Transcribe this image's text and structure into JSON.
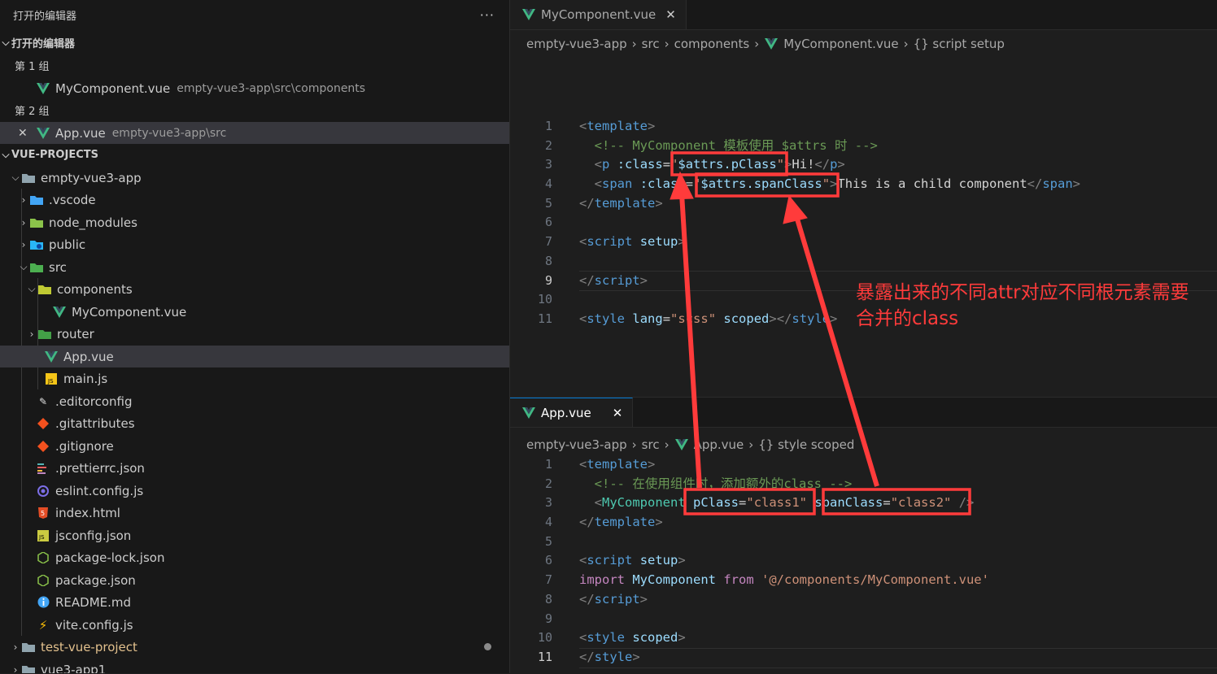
{
  "explorer": {
    "title": "打开的编辑器",
    "more": "···",
    "open_editors_section": "打开的编辑器",
    "group1": "第 1 组",
    "group1_file": "MyComponent.vue",
    "group1_path": "empty-vue3-app\\src\\components",
    "group2": "第 2 组",
    "group2_close": "✕",
    "group2_file": "App.vue",
    "group2_path": "empty-vue3-app\\src",
    "projects_section": "VUE-PROJECTS",
    "tree": [
      {
        "label": "empty-vue3-app",
        "icon": "folder-open-icon"
      },
      {
        "label": ".vscode",
        "icon": "vscode-folder-icon"
      },
      {
        "label": "node_modules",
        "icon": "node-folder-icon"
      },
      {
        "label": "public",
        "icon": "public-folder-icon"
      },
      {
        "label": "src",
        "icon": "src-folder-icon"
      },
      {
        "label": "components",
        "icon": "components-folder-icon"
      },
      {
        "label": "MyComponent.vue",
        "icon": "vue-icon"
      },
      {
        "label": "router",
        "icon": "router-folder-icon"
      },
      {
        "label": "App.vue",
        "icon": "vue-icon"
      },
      {
        "label": "main.js",
        "icon": "js-icon"
      },
      {
        "label": ".editorconfig",
        "icon": "editorconfig-icon"
      },
      {
        "label": ".gitattributes",
        "icon": "git-icon"
      },
      {
        "label": ".gitignore",
        "icon": "git-icon"
      },
      {
        "label": ".prettierrc.json",
        "icon": "prettier-icon"
      },
      {
        "label": "eslint.config.js",
        "icon": "eslint-icon"
      },
      {
        "label": "index.html",
        "icon": "html-icon"
      },
      {
        "label": "jsconfig.json",
        "icon": "json-icon"
      },
      {
        "label": "package-lock.json",
        "icon": "npm-icon"
      },
      {
        "label": "package.json",
        "icon": "npm-icon"
      },
      {
        "label": "README.md",
        "icon": "info-icon"
      },
      {
        "label": "vite.config.js",
        "icon": "vite-icon"
      },
      {
        "label": "test-vue-project",
        "icon": "folder-icon"
      },
      {
        "label": "vue3-app1",
        "icon": "folder-icon"
      }
    ]
  },
  "editor_top": {
    "tab_label": "MyComponent.vue",
    "tab_close": "✕",
    "breadcrumb": [
      "empty-vue3-app",
      "src",
      "components",
      "MyComponent.vue",
      "{} script setup"
    ],
    "line_numbers": [
      "1",
      "2",
      "3",
      "4",
      "5",
      "6",
      "7",
      "8",
      "9",
      "10",
      "11"
    ]
  },
  "editor_bottom": {
    "tab_label": "App.vue",
    "tab_close": "✕",
    "breadcrumb": [
      "empty-vue3-app",
      "src",
      "App.vue",
      "{} style scoped"
    ],
    "line_numbers": [
      "1",
      "2",
      "3",
      "4",
      "5",
      "6",
      "7",
      "8",
      "9",
      "10",
      "11"
    ]
  },
  "annotation": {
    "line1": "暴露出来的不同attr对应不同根元素需要",
    "line2": "合并的class",
    "color": "#ff3b3b"
  },
  "colors": {
    "tag": "#569cd6",
    "attr": "#9cdcfe",
    "string": "#ce9178",
    "comment": "#6a9955",
    "component": "#4ec9b0",
    "keyword": "#c586c0",
    "vue": "#41b883"
  }
}
